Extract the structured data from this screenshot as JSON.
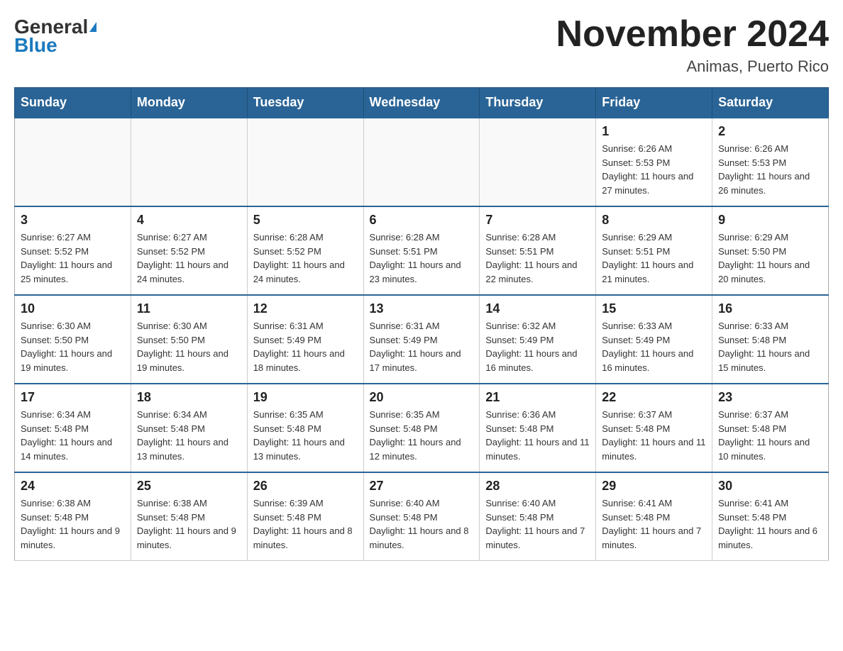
{
  "header": {
    "logo_general": "General",
    "logo_blue": "Blue",
    "month_title": "November 2024",
    "location": "Animas, Puerto Rico"
  },
  "weekdays": [
    "Sunday",
    "Monday",
    "Tuesday",
    "Wednesday",
    "Thursday",
    "Friday",
    "Saturday"
  ],
  "weeks": [
    [
      {
        "day": "",
        "sunrise": "",
        "sunset": "",
        "daylight": ""
      },
      {
        "day": "",
        "sunrise": "",
        "sunset": "",
        "daylight": ""
      },
      {
        "day": "",
        "sunrise": "",
        "sunset": "",
        "daylight": ""
      },
      {
        "day": "",
        "sunrise": "",
        "sunset": "",
        "daylight": ""
      },
      {
        "day": "",
        "sunrise": "",
        "sunset": "",
        "daylight": ""
      },
      {
        "day": "1",
        "sunrise": "Sunrise: 6:26 AM",
        "sunset": "Sunset: 5:53 PM",
        "daylight": "Daylight: 11 hours and 27 minutes."
      },
      {
        "day": "2",
        "sunrise": "Sunrise: 6:26 AM",
        "sunset": "Sunset: 5:53 PM",
        "daylight": "Daylight: 11 hours and 26 minutes."
      }
    ],
    [
      {
        "day": "3",
        "sunrise": "Sunrise: 6:27 AM",
        "sunset": "Sunset: 5:52 PM",
        "daylight": "Daylight: 11 hours and 25 minutes."
      },
      {
        "day": "4",
        "sunrise": "Sunrise: 6:27 AM",
        "sunset": "Sunset: 5:52 PM",
        "daylight": "Daylight: 11 hours and 24 minutes."
      },
      {
        "day": "5",
        "sunrise": "Sunrise: 6:28 AM",
        "sunset": "Sunset: 5:52 PM",
        "daylight": "Daylight: 11 hours and 24 minutes."
      },
      {
        "day": "6",
        "sunrise": "Sunrise: 6:28 AM",
        "sunset": "Sunset: 5:51 PM",
        "daylight": "Daylight: 11 hours and 23 minutes."
      },
      {
        "day": "7",
        "sunrise": "Sunrise: 6:28 AM",
        "sunset": "Sunset: 5:51 PM",
        "daylight": "Daylight: 11 hours and 22 minutes."
      },
      {
        "day": "8",
        "sunrise": "Sunrise: 6:29 AM",
        "sunset": "Sunset: 5:51 PM",
        "daylight": "Daylight: 11 hours and 21 minutes."
      },
      {
        "day": "9",
        "sunrise": "Sunrise: 6:29 AM",
        "sunset": "Sunset: 5:50 PM",
        "daylight": "Daylight: 11 hours and 20 minutes."
      }
    ],
    [
      {
        "day": "10",
        "sunrise": "Sunrise: 6:30 AM",
        "sunset": "Sunset: 5:50 PM",
        "daylight": "Daylight: 11 hours and 19 minutes."
      },
      {
        "day": "11",
        "sunrise": "Sunrise: 6:30 AM",
        "sunset": "Sunset: 5:50 PM",
        "daylight": "Daylight: 11 hours and 19 minutes."
      },
      {
        "day": "12",
        "sunrise": "Sunrise: 6:31 AM",
        "sunset": "Sunset: 5:49 PM",
        "daylight": "Daylight: 11 hours and 18 minutes."
      },
      {
        "day": "13",
        "sunrise": "Sunrise: 6:31 AM",
        "sunset": "Sunset: 5:49 PM",
        "daylight": "Daylight: 11 hours and 17 minutes."
      },
      {
        "day": "14",
        "sunrise": "Sunrise: 6:32 AM",
        "sunset": "Sunset: 5:49 PM",
        "daylight": "Daylight: 11 hours and 16 minutes."
      },
      {
        "day": "15",
        "sunrise": "Sunrise: 6:33 AM",
        "sunset": "Sunset: 5:49 PM",
        "daylight": "Daylight: 11 hours and 16 minutes."
      },
      {
        "day": "16",
        "sunrise": "Sunrise: 6:33 AM",
        "sunset": "Sunset: 5:48 PM",
        "daylight": "Daylight: 11 hours and 15 minutes."
      }
    ],
    [
      {
        "day": "17",
        "sunrise": "Sunrise: 6:34 AM",
        "sunset": "Sunset: 5:48 PM",
        "daylight": "Daylight: 11 hours and 14 minutes."
      },
      {
        "day": "18",
        "sunrise": "Sunrise: 6:34 AM",
        "sunset": "Sunset: 5:48 PM",
        "daylight": "Daylight: 11 hours and 13 minutes."
      },
      {
        "day": "19",
        "sunrise": "Sunrise: 6:35 AM",
        "sunset": "Sunset: 5:48 PM",
        "daylight": "Daylight: 11 hours and 13 minutes."
      },
      {
        "day": "20",
        "sunrise": "Sunrise: 6:35 AM",
        "sunset": "Sunset: 5:48 PM",
        "daylight": "Daylight: 11 hours and 12 minutes."
      },
      {
        "day": "21",
        "sunrise": "Sunrise: 6:36 AM",
        "sunset": "Sunset: 5:48 PM",
        "daylight": "Daylight: 11 hours and 11 minutes."
      },
      {
        "day": "22",
        "sunrise": "Sunrise: 6:37 AM",
        "sunset": "Sunset: 5:48 PM",
        "daylight": "Daylight: 11 hours and 11 minutes."
      },
      {
        "day": "23",
        "sunrise": "Sunrise: 6:37 AM",
        "sunset": "Sunset: 5:48 PM",
        "daylight": "Daylight: 11 hours and 10 minutes."
      }
    ],
    [
      {
        "day": "24",
        "sunrise": "Sunrise: 6:38 AM",
        "sunset": "Sunset: 5:48 PM",
        "daylight": "Daylight: 11 hours and 9 minutes."
      },
      {
        "day": "25",
        "sunrise": "Sunrise: 6:38 AM",
        "sunset": "Sunset: 5:48 PM",
        "daylight": "Daylight: 11 hours and 9 minutes."
      },
      {
        "day": "26",
        "sunrise": "Sunrise: 6:39 AM",
        "sunset": "Sunset: 5:48 PM",
        "daylight": "Daylight: 11 hours and 8 minutes."
      },
      {
        "day": "27",
        "sunrise": "Sunrise: 6:40 AM",
        "sunset": "Sunset: 5:48 PM",
        "daylight": "Daylight: 11 hours and 8 minutes."
      },
      {
        "day": "28",
        "sunrise": "Sunrise: 6:40 AM",
        "sunset": "Sunset: 5:48 PM",
        "daylight": "Daylight: 11 hours and 7 minutes."
      },
      {
        "day": "29",
        "sunrise": "Sunrise: 6:41 AM",
        "sunset": "Sunset: 5:48 PM",
        "daylight": "Daylight: 11 hours and 7 minutes."
      },
      {
        "day": "30",
        "sunrise": "Sunrise: 6:41 AM",
        "sunset": "Sunset: 5:48 PM",
        "daylight": "Daylight: 11 hours and 6 minutes."
      }
    ]
  ]
}
